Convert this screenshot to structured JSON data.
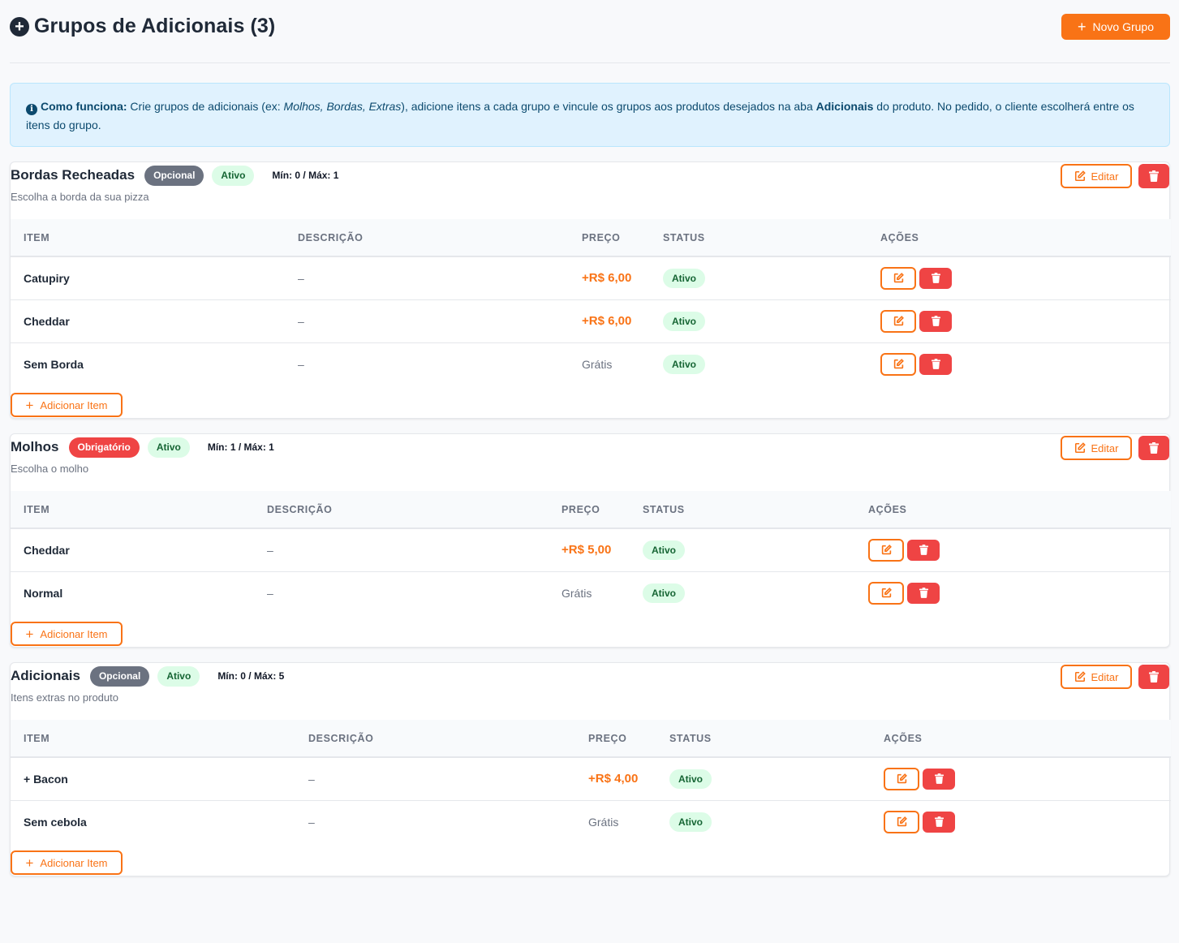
{
  "header": {
    "title": "Grupos de Adicionais (3)",
    "new_group_label": "Novo Grupo"
  },
  "info": {
    "lead": "Como funciona:",
    "text1": " Crie grupos de adicionais (ex: ",
    "examples": "Molhos, Bordas, Extras",
    "text2": "), adicione itens a cada grupo e vincule os grupos aos produtos desejados na aba ",
    "tab_name": "Adicionais",
    "text3": " do produto. No pedido, o cliente escolherá entre os itens do grupo."
  },
  "labels": {
    "edit": "Editar",
    "add_item": "Adicionar Item",
    "col_item": "ITEM",
    "col_desc": "DESCRIÇÃO",
    "col_price": "PREÇO",
    "col_status": "STATUS",
    "col_actions": "AÇÕES"
  },
  "colors": {
    "accent": "#f97316",
    "danger": "#ef4444",
    "success_bg": "#dcfce7",
    "success_text": "#166534",
    "info_bg": "#e0f2fe"
  },
  "groups": [
    {
      "name": "Bordas Recheadas",
      "type": "Opcional",
      "status": "Ativo",
      "minmax": "Mín: 0 / Máx: 1",
      "description": "Escolha a borda da sua pizza",
      "items": [
        {
          "name": "Catupiry",
          "desc": "–",
          "price": "+R$ 6,00",
          "status": "Ativo"
        },
        {
          "name": "Cheddar",
          "desc": "–",
          "price": "+R$ 6,00",
          "status": "Ativo"
        },
        {
          "name": "Sem Borda",
          "desc": "–",
          "price": "Grátis",
          "status": "Ativo"
        }
      ]
    },
    {
      "name": "Molhos",
      "type": "Obrigatório",
      "status": "Ativo",
      "minmax": "Mín: 1 / Máx: 1",
      "description": "Escolha o molho",
      "items": [
        {
          "name": "Cheddar",
          "desc": "–",
          "price": "+R$ 5,00",
          "status": "Ativo"
        },
        {
          "name": "Normal",
          "desc": "–",
          "price": "Grátis",
          "status": "Ativo"
        }
      ]
    },
    {
      "name": "Adicionais",
      "type": "Opcional",
      "status": "Ativo",
      "minmax": "Mín: 0 / Máx: 5",
      "description": "Itens extras no produto",
      "items": [
        {
          "name": "+ Bacon",
          "desc": "–",
          "price": "+R$ 4,00",
          "status": "Ativo"
        },
        {
          "name": "Sem cebola",
          "desc": "–",
          "price": "Grátis",
          "status": "Ativo"
        }
      ]
    }
  ]
}
